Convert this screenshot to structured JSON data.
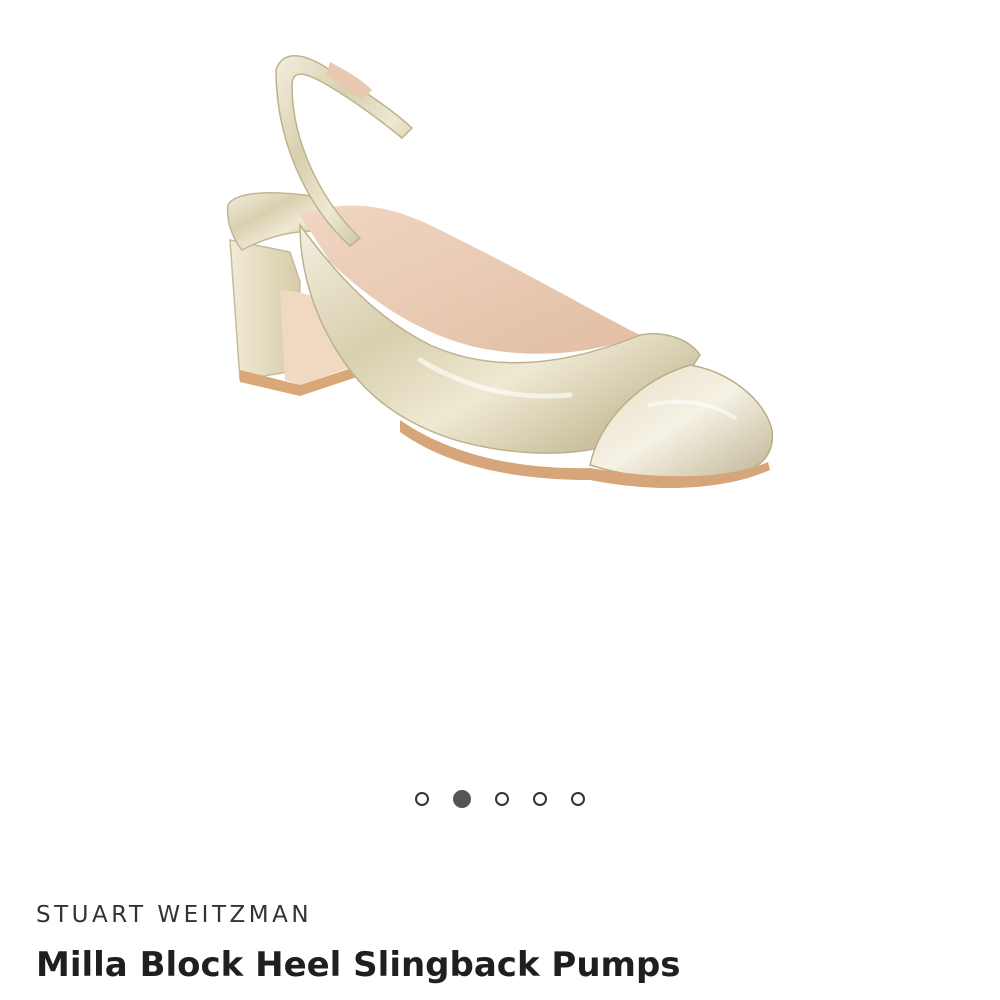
{
  "product": {
    "brand": "STUART WEITZMAN",
    "title": "Milla Block Heel Slingback Pumps",
    "image_alt": "metallic gold slingback block heel pump"
  },
  "gallery": {
    "image_count": 5,
    "active_index": 1,
    "dots": [
      {
        "label": "image-1",
        "active": false
      },
      {
        "label": "image-2",
        "active": true
      },
      {
        "label": "image-3",
        "active": false
      },
      {
        "label": "image-4",
        "active": false
      },
      {
        "label": "image-5",
        "active": false
      }
    ]
  },
  "colors": {
    "background": "#ffffff",
    "text_primary": "#1f1f1f",
    "text_brand": "#333333",
    "dot_active": "#555555",
    "shoe_metallic": "#d9d2b5",
    "shoe_lining": "#e7c9b2",
    "shoe_heel_base": "#d8a878"
  }
}
